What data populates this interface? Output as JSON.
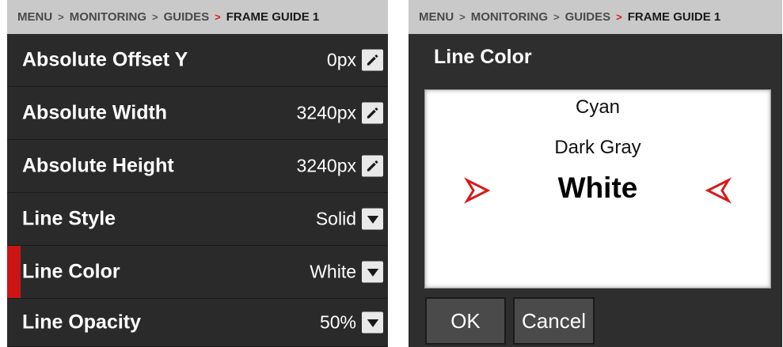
{
  "breadcrumb": {
    "items": [
      "MENU",
      "MONITORING",
      "GUIDES"
    ],
    "current": "FRAME GUIDE 1",
    "separator": ">"
  },
  "settings": [
    {
      "label": "Absolute Offset Y",
      "value": "0px",
      "control": "edit-icon"
    },
    {
      "label": "Absolute Width",
      "value": "3240px",
      "control": "edit-icon"
    },
    {
      "label": "Absolute Height",
      "value": "3240px",
      "control": "edit-icon"
    },
    {
      "label": "Line Style",
      "value": "Solid",
      "control": "dropdown-icon"
    },
    {
      "label": "Line Color",
      "value": "White",
      "control": "dropdown-icon",
      "selected": true
    },
    {
      "label": "Line Opacity",
      "value": "50%",
      "control": "dropdown-icon"
    }
  ],
  "dialog": {
    "title": "Line Color",
    "options": [
      "Cyan",
      "Dark Gray",
      "White"
    ],
    "selected": "White",
    "ok_label": "OK",
    "cancel_label": "Cancel"
  },
  "colors": {
    "accent": "#cc1414",
    "background": "#2a2a2a",
    "breadcrumb_bg": "#c9c9c9"
  }
}
